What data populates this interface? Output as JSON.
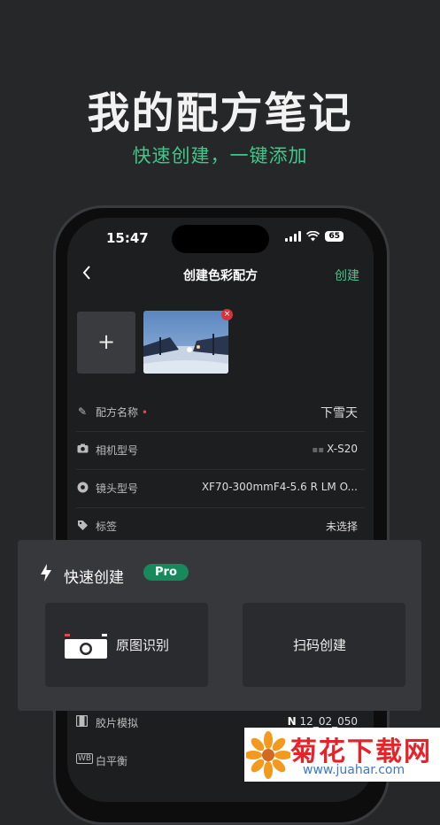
{
  "promo": {
    "headline": "我的配方笔记",
    "subline": "快速创建，一键添加"
  },
  "status_bar": {
    "time": "15:47",
    "battery": "65"
  },
  "nav": {
    "back_icon": "chevron-left-icon",
    "title": "创建色彩配方",
    "create_label": "创建"
  },
  "photos": {
    "add_label": "+",
    "remove_label": "×"
  },
  "form": {
    "name_label": "配方名称",
    "required_mark": "•",
    "name_value": "下雪天",
    "camera_label": "相机型号",
    "camera_value": "X-S20",
    "lens_label": "镜头型号",
    "lens_value": "XF70-300mmF4-5.6 R LM O...",
    "tag_label": "标签",
    "tag_value": "未选择",
    "film_label": "胶片模拟",
    "film_value": "12_02_050",
    "wb_badge": "WB",
    "wb_label": "白平衡"
  },
  "quick_create": {
    "title": "快速创建",
    "badge": "Pro",
    "photo_recognize_label": "原图识别",
    "scan_create_label": "扫码创建"
  },
  "watermark": {
    "title": "菊花下载网",
    "url": "www.juahar.com"
  },
  "colors": {
    "accent_green": "#3ec98a",
    "pro_badge": "#178a5c",
    "delete_red": "#d8333b"
  }
}
